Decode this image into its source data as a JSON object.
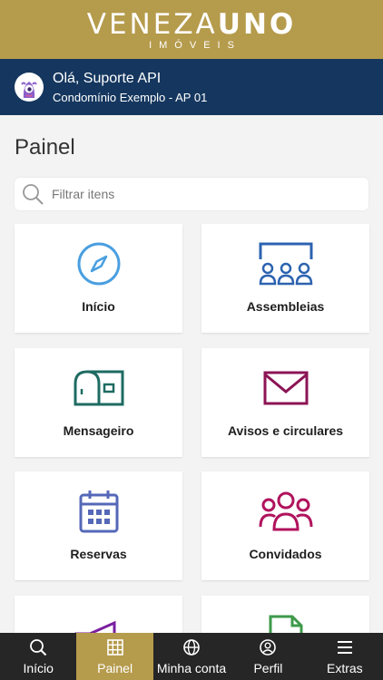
{
  "brand": {
    "name_light": "VENEZA",
    "name_bold": "UNO",
    "tagline": "IMÓVEIS"
  },
  "user": {
    "greeting": "Olá, Suporte API",
    "unit": "Condomínio Exemplo - AP 01"
  },
  "page": {
    "title": "Painel"
  },
  "search": {
    "placeholder": "Filtrar itens",
    "value": ""
  },
  "cards": [
    {
      "label": "Início",
      "icon": "compass-icon",
      "color": "#4a9fe0"
    },
    {
      "label": "Assembleias",
      "icon": "assembly-icon",
      "color": "#2c63b0"
    },
    {
      "label": "Mensageiro",
      "icon": "mailbox-icon",
      "color": "#1e6b62"
    },
    {
      "label": "Avisos e circulares",
      "icon": "envelope-icon",
      "color": "#8c1455"
    },
    {
      "label": "Reservas",
      "icon": "calendar-icon",
      "color": "#5568b8"
    },
    {
      "label": "Convidados",
      "icon": "guests-icon",
      "color": "#b0135d"
    },
    {
      "label": "",
      "icon": "megaphone-icon",
      "color": "#7a1fa0"
    },
    {
      "label": "",
      "icon": "document-icon",
      "color": "#3e9a4a"
    }
  ],
  "tabs": [
    {
      "label": "Início",
      "icon": "search-icon",
      "active": false
    },
    {
      "label": "Painel",
      "icon": "grid-icon",
      "active": true
    },
    {
      "label": "Minha conta",
      "icon": "globe-icon",
      "active": false
    },
    {
      "label": "Perfil",
      "icon": "profile-icon",
      "active": false
    },
    {
      "label": "Extras",
      "icon": "menu-icon",
      "active": false
    }
  ],
  "colors": {
    "gold": "#b59b4c",
    "navy": "#15375f",
    "tabbar": "#262626"
  }
}
